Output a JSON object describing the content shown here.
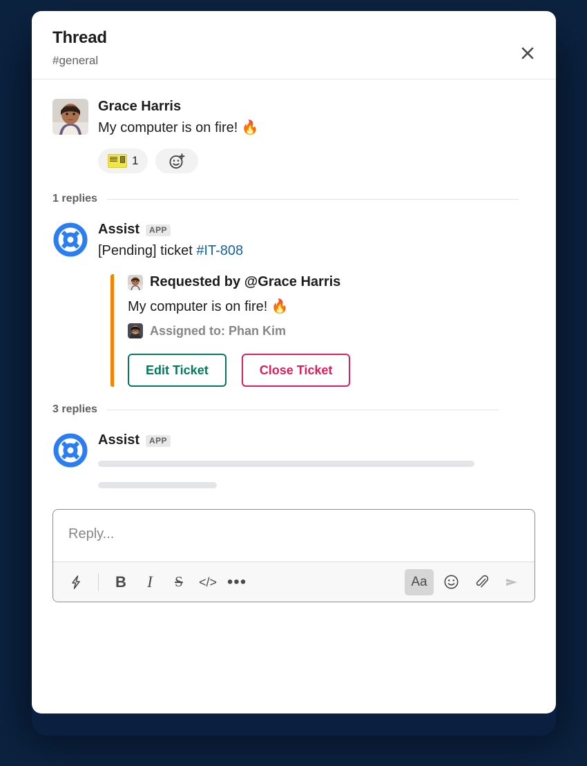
{
  "theme": {
    "page_background": "#0c2340",
    "card_background": "#ffffff",
    "accent_orange": "#f98300",
    "link_blue": "#1264a3",
    "bot_blue": "#2a7ef0",
    "green": "#007a5a",
    "pink": "#e01e5a"
  },
  "header": {
    "title": "Thread",
    "channel": "#general",
    "close_label": "×"
  },
  "root_message": {
    "author": "Grace Harris",
    "text": "My computer is on fire! 🔥",
    "avatar_name": "grace-harris-avatar",
    "reactions": [
      {
        "emoji_name": "ticket-emoji",
        "count": "1"
      }
    ],
    "add_reaction_label": "add-reaction"
  },
  "divider_1": {
    "label": "1 replies"
  },
  "reply_1": {
    "author": "Assist",
    "badge": "APP",
    "avatar_name": "assist-bot-lifering-icon",
    "text_prefix": "[Pending] ticket ",
    "ticket_link": "#IT-808",
    "attachment": {
      "requested_by": "Requested by @Grace Harris",
      "body": "My computer is on fire! 🔥",
      "assigned_to": "Assigned to: Phan Kim",
      "buttons": [
        {
          "label": "Edit Ticket",
          "style": "green"
        },
        {
          "label": "Close Ticket",
          "style": "pink"
        }
      ]
    }
  },
  "divider_2": {
    "label": "3 replies"
  },
  "reply_2": {
    "author": "Assist",
    "badge": "APP",
    "avatar_name": "assist-bot-lifering-icon",
    "loading": true
  },
  "composer": {
    "placeholder": "Reply...",
    "value": "",
    "toolbar_left": [
      {
        "name": "shortcuts-lightning-icon",
        "glyph": "⚡"
      },
      {
        "name": "bold-icon",
        "glyph": "B"
      },
      {
        "name": "italic-icon",
        "glyph": "I"
      },
      {
        "name": "strikethrough-icon",
        "glyph": "S"
      },
      {
        "name": "code-icon",
        "glyph": "</>"
      },
      {
        "name": "more-formatting-icon",
        "glyph": "•••"
      }
    ],
    "toolbar_right": [
      {
        "name": "formatting-aa-icon",
        "glyph": "Aa"
      },
      {
        "name": "emoji-icon",
        "glyph": "☺"
      },
      {
        "name": "attachment-icon",
        "glyph": "📎"
      },
      {
        "name": "send-icon",
        "glyph": "➤"
      }
    ]
  }
}
